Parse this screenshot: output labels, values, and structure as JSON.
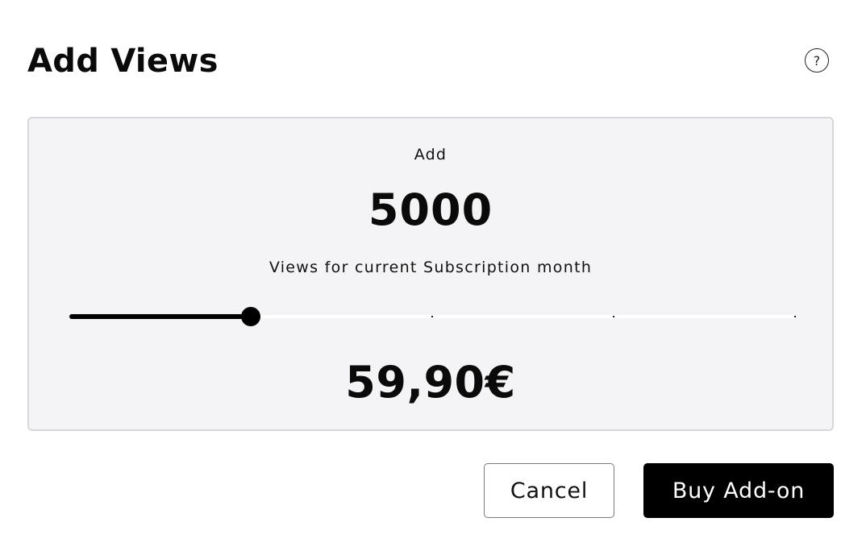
{
  "dialog": {
    "title": "Add Views",
    "help_icon": "question-mark-icon",
    "help_glyph": "?"
  },
  "panel": {
    "add_label": "Add",
    "views_amount": "5000",
    "views_caption": "Views for current Subscription month",
    "price": "59,90€"
  },
  "slider": {
    "value_fraction": 0.25,
    "tick_fractions": [
      0.5,
      0.75,
      1.0
    ]
  },
  "actions": {
    "cancel_label": "Cancel",
    "buy_label": "Buy Add-on"
  },
  "colors": {
    "panel_background": "#f4f3f6",
    "panel_border": "#d8d7db",
    "primary_button": "#000000",
    "primary_button_text": "#ffffff",
    "slider_fill": "#000000",
    "slider_track": "#ffffff"
  }
}
